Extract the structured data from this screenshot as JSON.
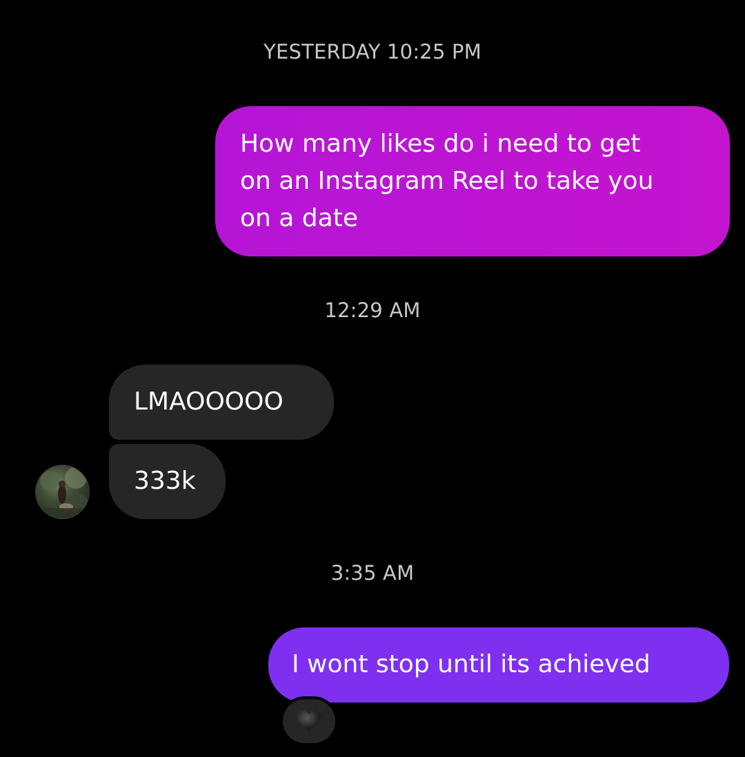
{
  "colors": {
    "background": "#000000",
    "outgoing_bubble_gradient_start": "#b515d6",
    "outgoing_bubble_gradient_end": "#c414cf",
    "outgoing_bubble_latest": "#7f2ff0",
    "incoming_bubble": "#262626",
    "timestamp_text": "#c8c8c8"
  },
  "thread": {
    "timestamps": {
      "first": "YESTERDAY 10:25 PM",
      "second": "12:29 AM",
      "third": "3:35 AM"
    },
    "messages": [
      {
        "direction": "outgoing",
        "text": "How many likes do i need to get\non an Instagram Reel to take you\non a date"
      },
      {
        "direction": "incoming",
        "text": "LMAOOOOO"
      },
      {
        "direction": "incoming",
        "text": "333k"
      },
      {
        "direction": "outgoing",
        "text": "I wont stop until its achieved",
        "reaction_icon": "black-heart-icon"
      }
    ],
    "sender_avatar_icon": "profile-photo-avatar"
  }
}
